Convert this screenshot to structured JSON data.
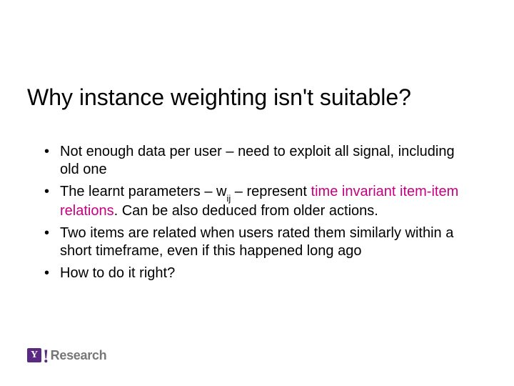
{
  "title": "Why instance weighting isn't suitable?",
  "bullets": {
    "b1": "Not enough data per user – need to exploit all signal, including old one",
    "b2a": "The learnt parameters – ",
    "b2_w": "w",
    "b2_sub": "ij",
    "b2b": " – represent ",
    "b2_span": "time invariant item-item relations",
    "b2c": ". Can be also deduced from older actions.",
    "b3": "Two items are related when users rated them similarly within a short timeframe, even if this happened long ago",
    "b4": "How to do it right?"
  },
  "footer": {
    "y": "Y",
    "bang": "!",
    "research": "Research"
  }
}
